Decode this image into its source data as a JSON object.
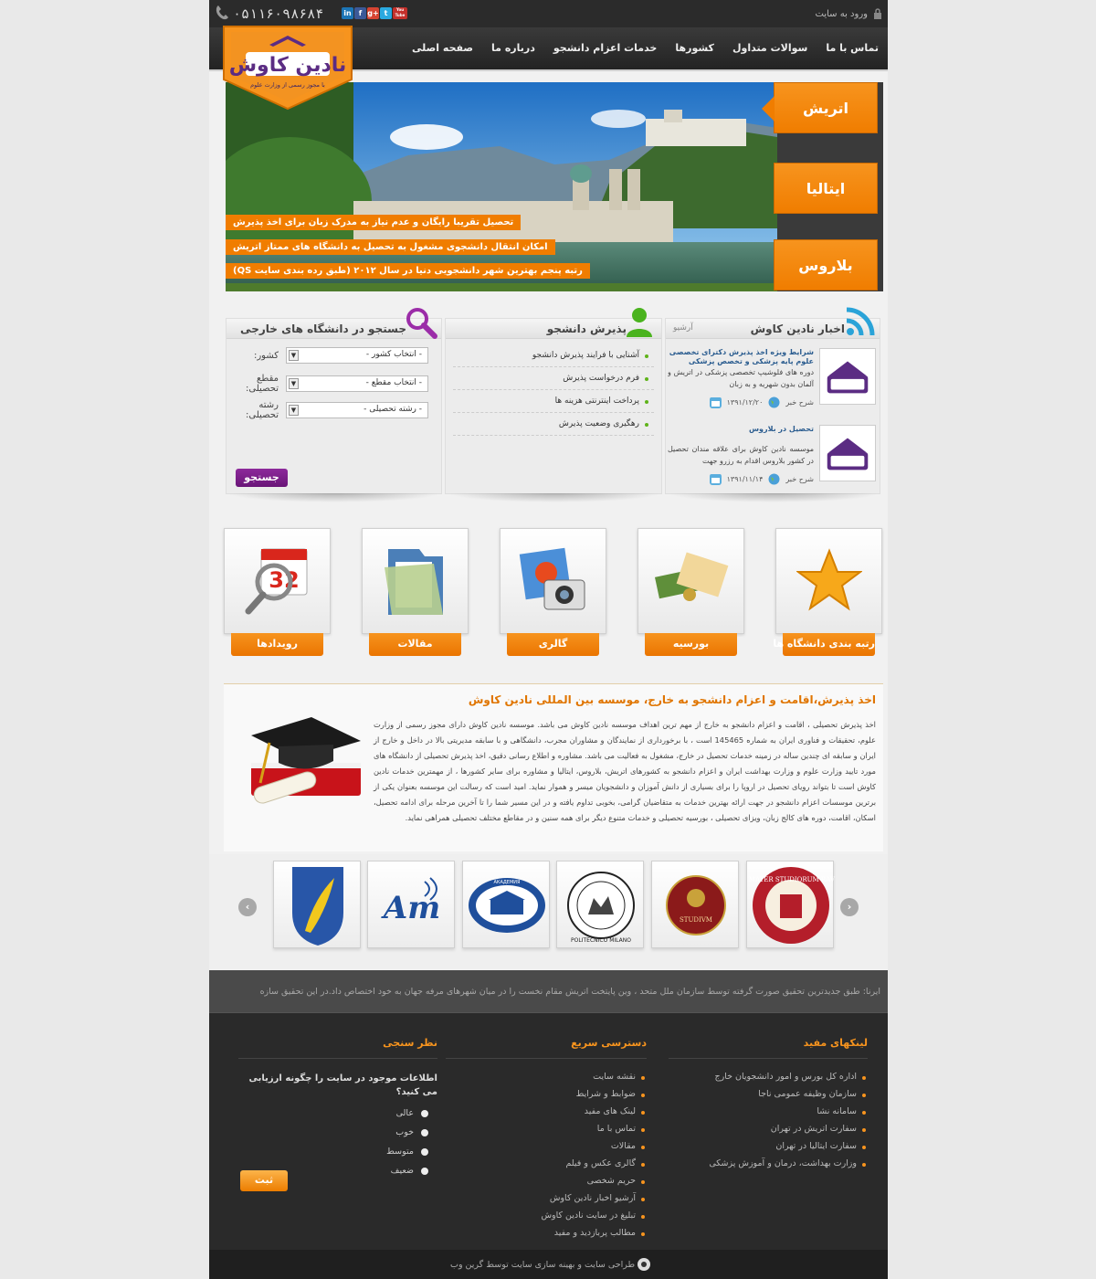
{
  "topbar": {
    "phone": "۰۵۱۱۶۰۹۸۶۸۴",
    "login": "ورود به سایت",
    "social": [
      {
        "icon": "linkedin-icon",
        "label": "in",
        "color": "#1c75b6"
      },
      {
        "icon": "facebook-icon",
        "label": "f",
        "color": "#3b5998"
      },
      {
        "icon": "google-plus-icon",
        "label": "g+",
        "color": "#d64432"
      },
      {
        "icon": "twitter-icon",
        "label": "t",
        "color": "#2aa9e0"
      },
      {
        "icon": "youtube-icon",
        "label": "You Tube",
        "color": "#c4302b"
      }
    ]
  },
  "nav": [
    "صفحه اصلی",
    "درباره ما",
    "خدمات اعزام دانشجو",
    "کشورها",
    "سوالات متداول",
    "تماس با ما"
  ],
  "logo": {
    "text": "نادین کاوش",
    "tagline": "با مجوز رسمی از وزارت علوم"
  },
  "slider": {
    "captions": [
      "تحصیل تقریبا رایگان و عدم نیاز به مدرک زبان برای اخذ پذیرش",
      "امکان انتقال دانشجوی مشغول به تحصیل به دانشگاه های ممتاز اتریش",
      "رتبه پنجم بهترین شهر دانشجویی دنیا در سال ۲۰۱۲ (طبق رده بندی سایت QS)"
    ],
    "tabs": [
      "اتریش",
      "ایتالیا",
      "بلاروس"
    ]
  },
  "search_box": {
    "title": "جستجو در دانشگاه های خارجی",
    "fields": [
      {
        "label": "کشور:",
        "value": "- انتخاب کشور -"
      },
      {
        "label": "مقطع تحصیلی:",
        "value": "- انتخاب مقطع -"
      },
      {
        "label": "رشته تحصیلی:",
        "value": "- رشته تحصیلی -"
      }
    ],
    "button": "جستجو"
  },
  "admission_box": {
    "title": "پذیرش دانشجو",
    "items": [
      "آشنایی با فرایند پذیرش دانشجو",
      "فرم درخواست پذیرش",
      "پرداخت اینترنتی هزینه ها",
      "رهگیری وضعیت پذیرش"
    ]
  },
  "news_box": {
    "title": "اخبار نادین کاوش",
    "archive": "آرشیو",
    "items": [
      {
        "title": "شرایط ویژه اخذ پذیرش دکترای تخصصی علوم پایه پزشکی و تخصص پزشکی",
        "text": "دوره های فلوشیپ تخصصی پزشکی در اتریش و آلمان بدون شهریه و به زبان",
        "more": "شرح خبر",
        "date": "۱۳۹۱/۱۲/۲۰"
      },
      {
        "title": "تحصیل در بلاروس",
        "text": "موسسه نادین کاوش برای علاقه مندان تحصیل در کشور بلاروس اقدام به رزرو جهت",
        "more": "شرح خبر",
        "date": "۱۳۹۱/۱۱/۱۴"
      }
    ]
  },
  "tiles": [
    {
      "label": "رتبه بندی دانشگاه ها",
      "icon": "star-icon"
    },
    {
      "label": "بورسیه",
      "icon": "money-certificate-icon"
    },
    {
      "label": "گالری",
      "icon": "camera-photo-icon"
    },
    {
      "label": "مقالات",
      "icon": "folder-icon"
    },
    {
      "label": "رویدادها",
      "icon": "calendar-search-icon"
    }
  ],
  "about": {
    "title": "اخذ پذیرش،اقامت و اعزام دانشجو به خارج، موسسه بین المللی نادین کاوش",
    "text": "اخذ پذیرش تحصیلی ، اقامت و اعزام دانشجو به خارج از مهم ترین اهداف موسسه نادین کاوش می باشد. موسسه نادین کاوش دارای مجوز رسمی از وزارت علوم، تحقیقات و فناوری ایران به شماره 145465 است ، با برخورداری از نمایندگان و مشاوران مجرب، دانشگاهی و با سابقه مدیریتی بالا در داخل و خارج از ایران و سابقه ای چندین ساله در زمینه خدمات تحصیل در خارج، مشغول به فعالیت می باشد. مشاوره و اطلاع رسانی دقیق، اخذ پذیرش تحصیلی از دانشگاه های مورد تایید وزارت علوم و وزارت بهداشت ایران و اعزام دانشجو به کشورهای اتریش، بلاروس، ایتالیا و مشاوره برای سایر کشورها ، از مهمترین خدمات نادین کاوش است تا بتواند رویای تحصیل در اروپا را برای بسیاری از دانش آموزان و دانشجویان میسر و هموار نماید. امید است که رسالت این موسسه بعنوان یکی از برترین موسسات اعزام دانشجو در جهت ارائه بهترین خدمات به متقاضیان گرامی، بخوبی تداوم یافته و در این مسیر شما را تا آخرین مرحله برای ادامه تحصیل، اسکان، اقامت، دوره های کالج زبان، ویزای تحصیلی ، بورسیه تحصیلی و خدمات متنوع دیگر برای همه سنین و در مقاطع مختلف تحصیلی همراهی نماید."
  },
  "partners": [
    {
      "name": "alma-mater-studiorum-ravenna-logo",
      "text": "ALMA MATER STUDIORUM RAVENNA",
      "color": "#b41e2a"
    },
    {
      "name": "studium-seal-logo",
      "text": "STUDIVM",
      "color": "#8b1a1a"
    },
    {
      "name": "politecnico-milano-logo",
      "text": "POLITECNICO MILANO",
      "color": "#222222"
    },
    {
      "name": "belarus-academy-logo",
      "text": "АКАДЕМИЯ",
      "color": "#1f4f9c"
    },
    {
      "name": "am-logo",
      "text": "Am",
      "color": "#1f4f9c"
    },
    {
      "name": "feather-shield-logo",
      "text": "",
      "color": "#2856a8"
    }
  ],
  "ticker": "ایرنا: طبق جدیدترین تحقیق صورت گرفته توسط سازمان ملل متحد ، وین پایتخت اتریش مقام نخست را در میان شهرهای مرفه جهان به خود اختصاص داد.در این تحقیق سازه",
  "footer": {
    "links": {
      "title": "لینکهای مفید",
      "items": [
        "اداره کل بورس و امور دانشجویان خارج",
        "سازمان وظیفه عمومی ناجا",
        "سامانه نشا",
        "سفارت اتریش در تهران",
        "سفارت ایتالیا در تهران",
        "وزارت بهداشت، درمان و آموزش پزشکی"
      ]
    },
    "quick": {
      "title": "دسترسی سریع",
      "items": [
        "نقشه سایت",
        "ضوابط و شرایط",
        "لینک های مفید",
        "تماس با ما",
        "مقالات",
        "گالری عکس و فیلم",
        "حریم شخصی",
        "آرشیو اخبار نادین کاوش",
        "تبلیغ در سایت نادین کاوش",
        "مطالب پربازدید و مفید"
      ]
    },
    "poll": {
      "title": "نظر سنجی",
      "question": "اطلاعات موجود در سایت را چگونه ارزیابی می کنید؟",
      "options": [
        "عالی",
        "خوب",
        "متوسط",
        "ضعیف"
      ],
      "button": "ثبت"
    },
    "copyright": "طراحی سایت و بهینه سازی سایت توسط گرین وب"
  }
}
